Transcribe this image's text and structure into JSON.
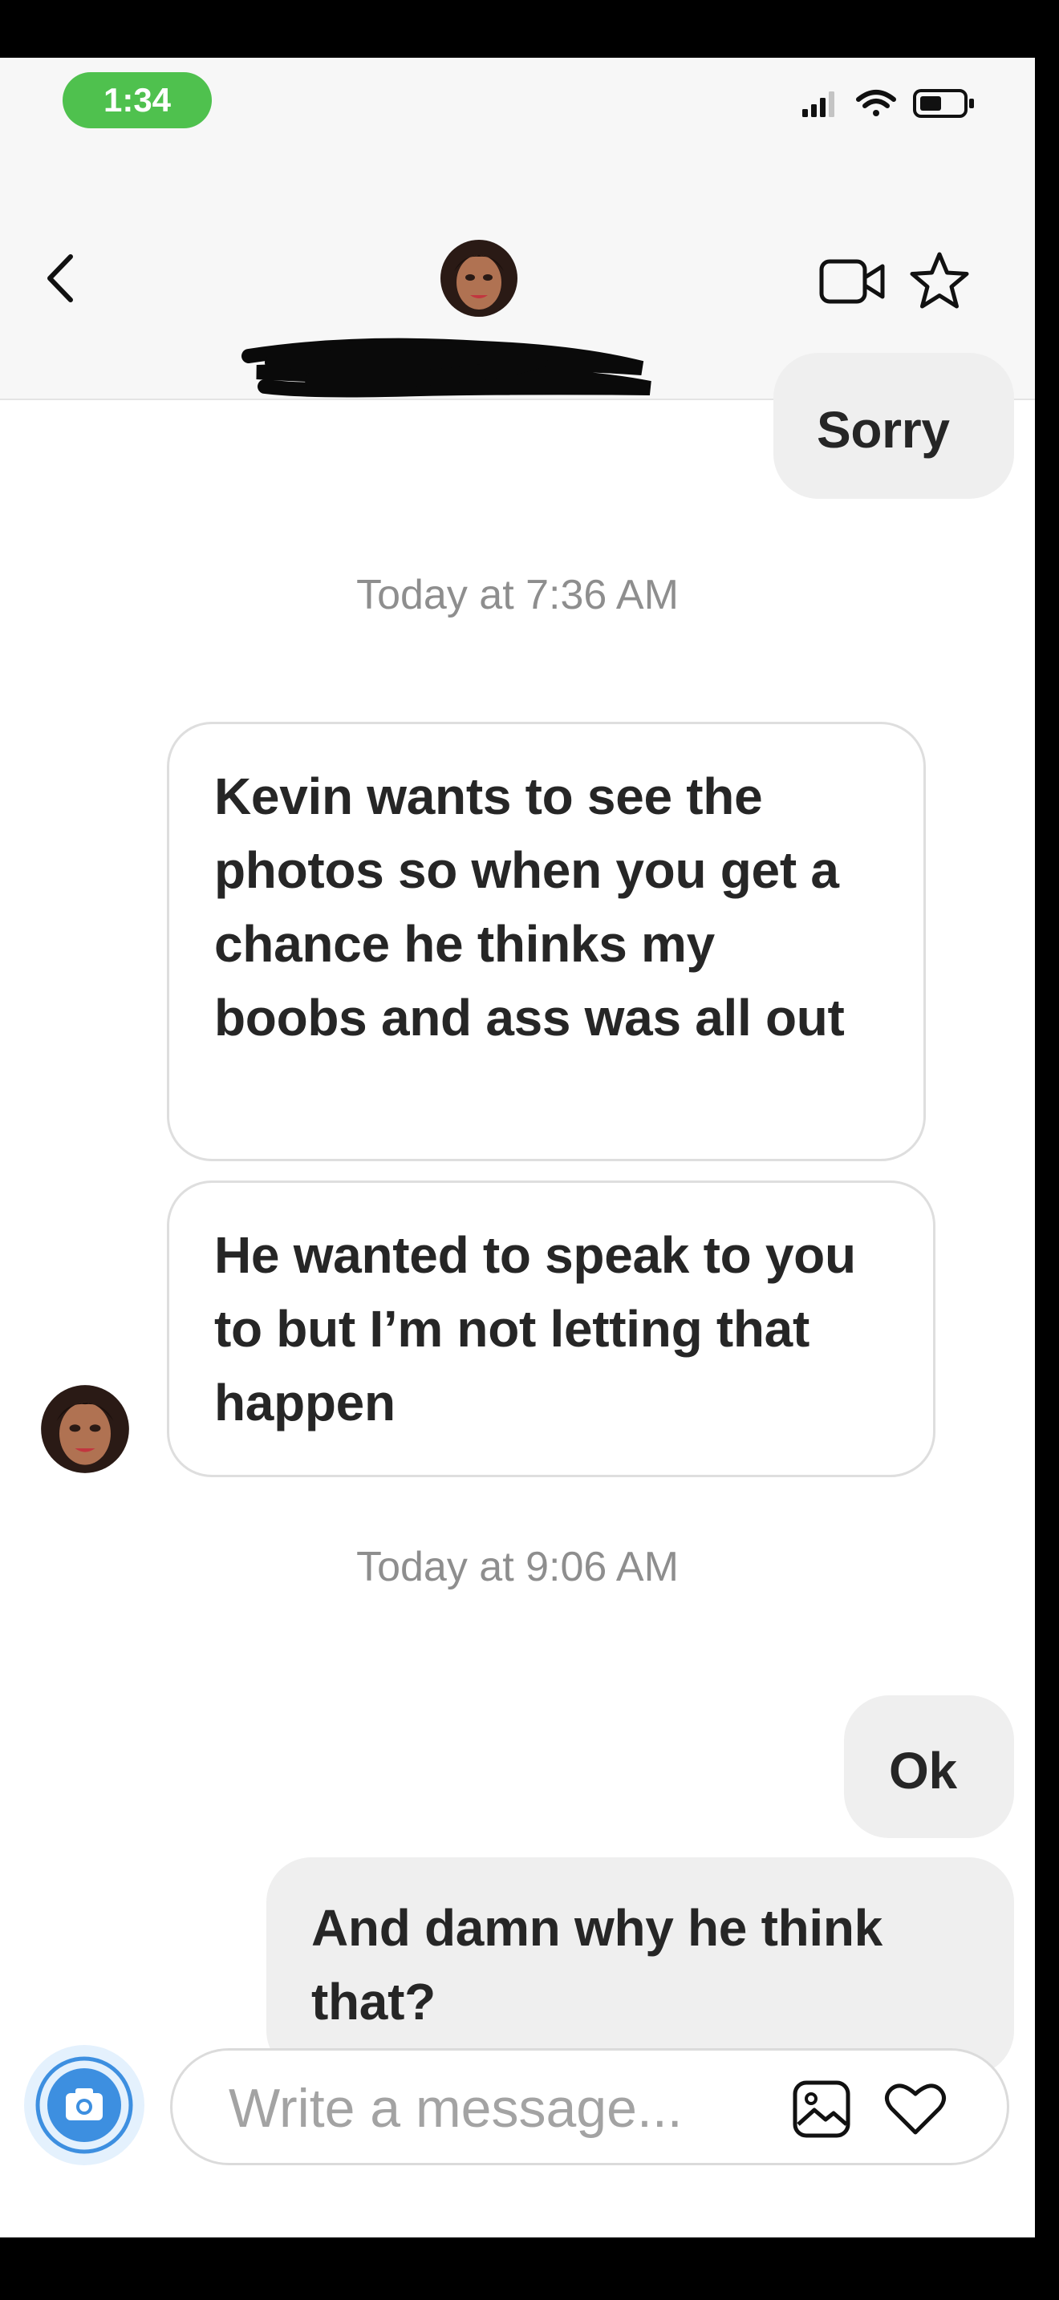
{
  "status_bar": {
    "time": "1:34"
  },
  "header": {
    "back_icon": "chevron-left-icon",
    "video_icon": "video-camera-icon",
    "star_icon": "star-outline-icon"
  },
  "conversation": {
    "messages": [
      {
        "type": "sent",
        "text": "Sorry"
      },
      {
        "type": "timestamp",
        "text": "Today at 7:36 AM"
      },
      {
        "type": "received",
        "text": "Kevin wants to see the photos so when you get a chance  he thinks my boobs and ass was all out"
      },
      {
        "type": "received",
        "text": "He wanted to speak to you to but I’m not letting that happen"
      },
      {
        "type": "timestamp",
        "text": "Today at 9:06 AM"
      },
      {
        "type": "sent",
        "text": "Ok"
      },
      {
        "type": "sent",
        "text": "And damn why he think that?"
      }
    ]
  },
  "composer": {
    "placeholder": "Write a message...",
    "camera_icon": "camera-icon",
    "gallery_icon": "image-gallery-icon",
    "heart_icon": "heart-outline-icon",
    "camera_color": "#3d8fe0"
  }
}
